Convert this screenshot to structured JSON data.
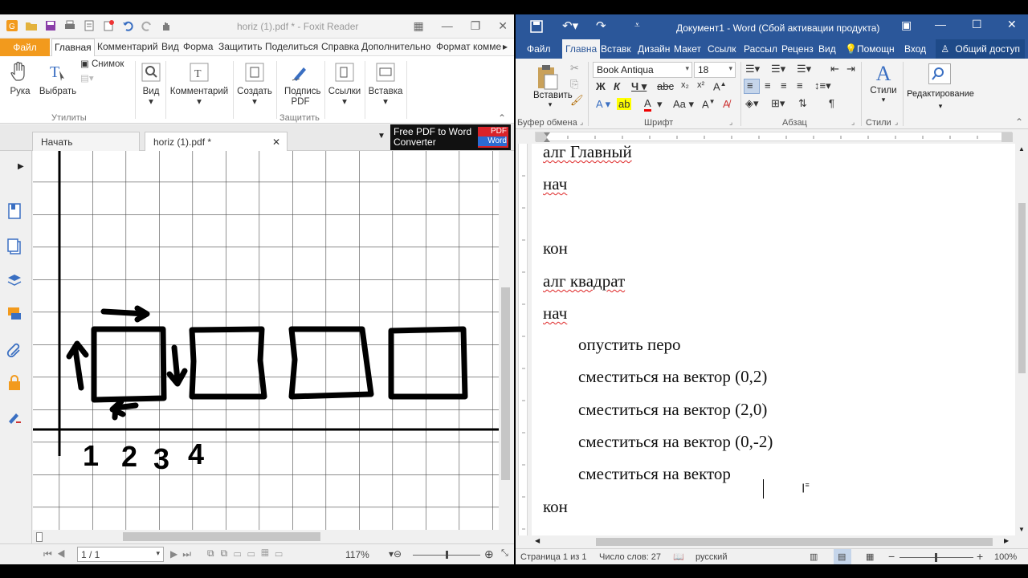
{
  "foxit": {
    "title": "horiz (1).pdf * - Foxit Reader",
    "tabs": [
      "Файл",
      "Главная",
      "Комментарий",
      "Вид",
      "Форма",
      "Защитить",
      "Поделиться",
      "Справка",
      "Дополнительно",
      "Формат комме"
    ],
    "ribbon": {
      "hand": "Рука",
      "select": "Выбрать",
      "snapshot": "Снимок",
      "view": "Вид",
      "comment": "Комментарий",
      "create": "Создать",
      "sign": "Подпись PDF",
      "links": "Ссылки",
      "insert": "Вставка",
      "group_utils": "Утилиты",
      "group_protect": "Защитить"
    },
    "doc_tabs": [
      "Начать",
      "horiz (1).pdf *"
    ],
    "ad": {
      "text": "Free PDF to Word Converter",
      "badge_pdf": "PDF",
      "badge_word": "Word"
    },
    "drawing_numbers": [
      "1",
      "2",
      "3",
      "4"
    ],
    "status": {
      "page": "1 / 1",
      "zoom": "117%"
    }
  },
  "word": {
    "title": "Документ1 - Word (Сбой активации продукта)",
    "tabs": [
      "Файл",
      "Главна",
      "Вставк",
      "Дизайн",
      "Макет",
      "Ссылк",
      "Рассыл",
      "Реценз",
      "Вид",
      "Помощн",
      "Вход"
    ],
    "share": "Общий доступ",
    "ribbon": {
      "paste": "Вставить",
      "font": "Book Antiqua",
      "size": "18",
      "styles": "Стили",
      "editing": "Редактирование",
      "group_clipboard": "Буфер обмена",
      "group_font": "Шрифт",
      "group_paragraph": "Абзац",
      "group_styles": "Стили"
    },
    "lines": [
      "алг Главный",
      "нач",
      "кон",
      "алг квадрат",
      "нач",
      "опустить перо",
      "сместиться на вектор (0,2)",
      "сместиться на вектор (2,0)",
      "сместиться на вектор (0,-2)",
      "сместиться на вектор",
      "кон"
    ],
    "status": {
      "page": "Страница 1 из 1",
      "words": "Число слов: 27",
      "language": "русский",
      "zoom": "100%"
    }
  }
}
